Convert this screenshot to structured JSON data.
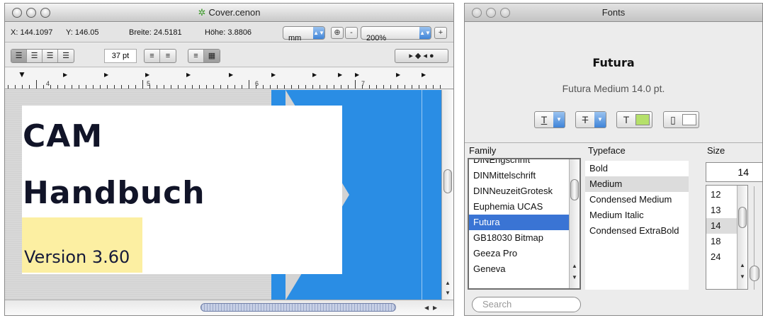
{
  "doc_window": {
    "title": "Cover.cenon",
    "info": {
      "x_label": "X: 144.1097",
      "y_label": "Y: 146.05",
      "width_label": "Breite: 24.5181",
      "height_label": "Höhe: 3.8806",
      "unit": "mm",
      "zoom": "200%",
      "zoom_in": "+",
      "zoom_out": "-"
    },
    "format": {
      "font_size": "37 pt"
    },
    "ruler_numbers": [
      "4",
      "5",
      "6",
      "7"
    ],
    "cover": {
      "line1": "CAM",
      "line2": "Handbuch",
      "version": "Version 3.60"
    },
    "colors": {
      "blue_panel": "#2a8de4",
      "highlight": "#fcefa2",
      "title_text": "#111428"
    }
  },
  "font_window": {
    "title": "Fonts",
    "preview_name": "Futura",
    "preview_detail": "Futura Medium 14.0 pt.",
    "family_header": "Family",
    "typeface_header": "Typeface",
    "size_header": "Size",
    "families": [
      {
        "name": "DINEngschrift",
        "selected": false
      },
      {
        "name": "DINMittelschrift",
        "selected": false
      },
      {
        "name": "DINNeuzeitGrotesk",
        "selected": false
      },
      {
        "name": "Euphemia UCAS",
        "selected": false
      },
      {
        "name": "Futura",
        "selected": true
      },
      {
        "name": "GB18030 Bitmap",
        "selected": false
      },
      {
        "name": "Geeza Pro",
        "selected": false
      },
      {
        "name": "Geneva",
        "selected": false
      }
    ],
    "typefaces": [
      {
        "name": "Bold",
        "selected": false
      },
      {
        "name": "Medium",
        "selected": true
      },
      {
        "name": "Condensed Medium",
        "selected": false
      },
      {
        "name": "Medium Italic",
        "selected": false
      },
      {
        "name": "Condensed ExtraBold",
        "selected": false
      }
    ],
    "size_value": "14",
    "sizes": [
      {
        "value": "12",
        "selected": false
      },
      {
        "value": "13",
        "selected": false
      },
      {
        "value": "14",
        "selected": true
      },
      {
        "value": "18",
        "selected": false
      },
      {
        "value": "24",
        "selected": false
      }
    ],
    "search_placeholder": "Search",
    "color_swatch": "#b5e06a"
  }
}
